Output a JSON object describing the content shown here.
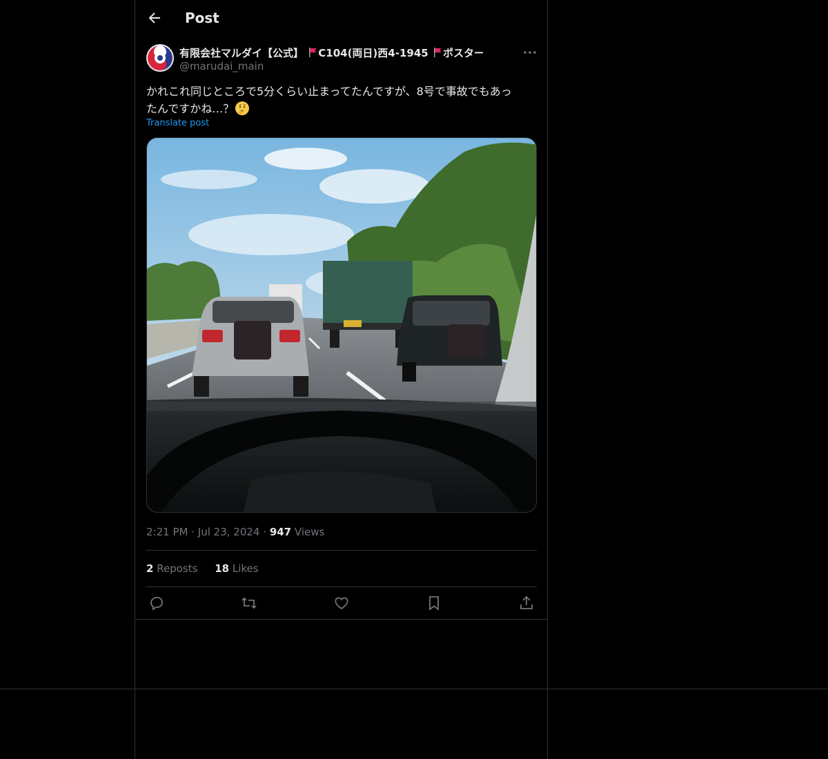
{
  "header": {
    "title": "Post"
  },
  "author": {
    "display_name": "有限会社マルダイ【公式】",
    "display_name_rest_1": "C104(両日)西4-1945",
    "display_name_rest_2": "ポスタースタンド、",
    "handle": "@marudai_main"
  },
  "post": {
    "text_line1": "かれこれ同じところで5分くらい止まってたんですが、8号で事故でもあっ",
    "text_line2": "たんですかね…？",
    "translate_label": "Translate post",
    "media_alt": "Image"
  },
  "meta": {
    "time": "2:21 PM",
    "dot1": "·",
    "date": "Jul 23, 2024",
    "dot2": "·",
    "views_count": "947",
    "views_label": "Views"
  },
  "stats": {
    "reposts_count": "2",
    "reposts_label": "Reposts",
    "likes_count": "18",
    "likes_label": "Likes"
  },
  "icons": {
    "back": "arrow-left-icon",
    "more": "more-icon",
    "reply": "reply-icon",
    "repost": "repost-icon",
    "like": "heart-icon",
    "bookmark": "bookmark-icon",
    "share": "share-icon"
  },
  "colors": {
    "link": "#1d9bf0",
    "muted": "#71767b",
    "text": "#e7e9ea",
    "border": "#2f3336"
  }
}
